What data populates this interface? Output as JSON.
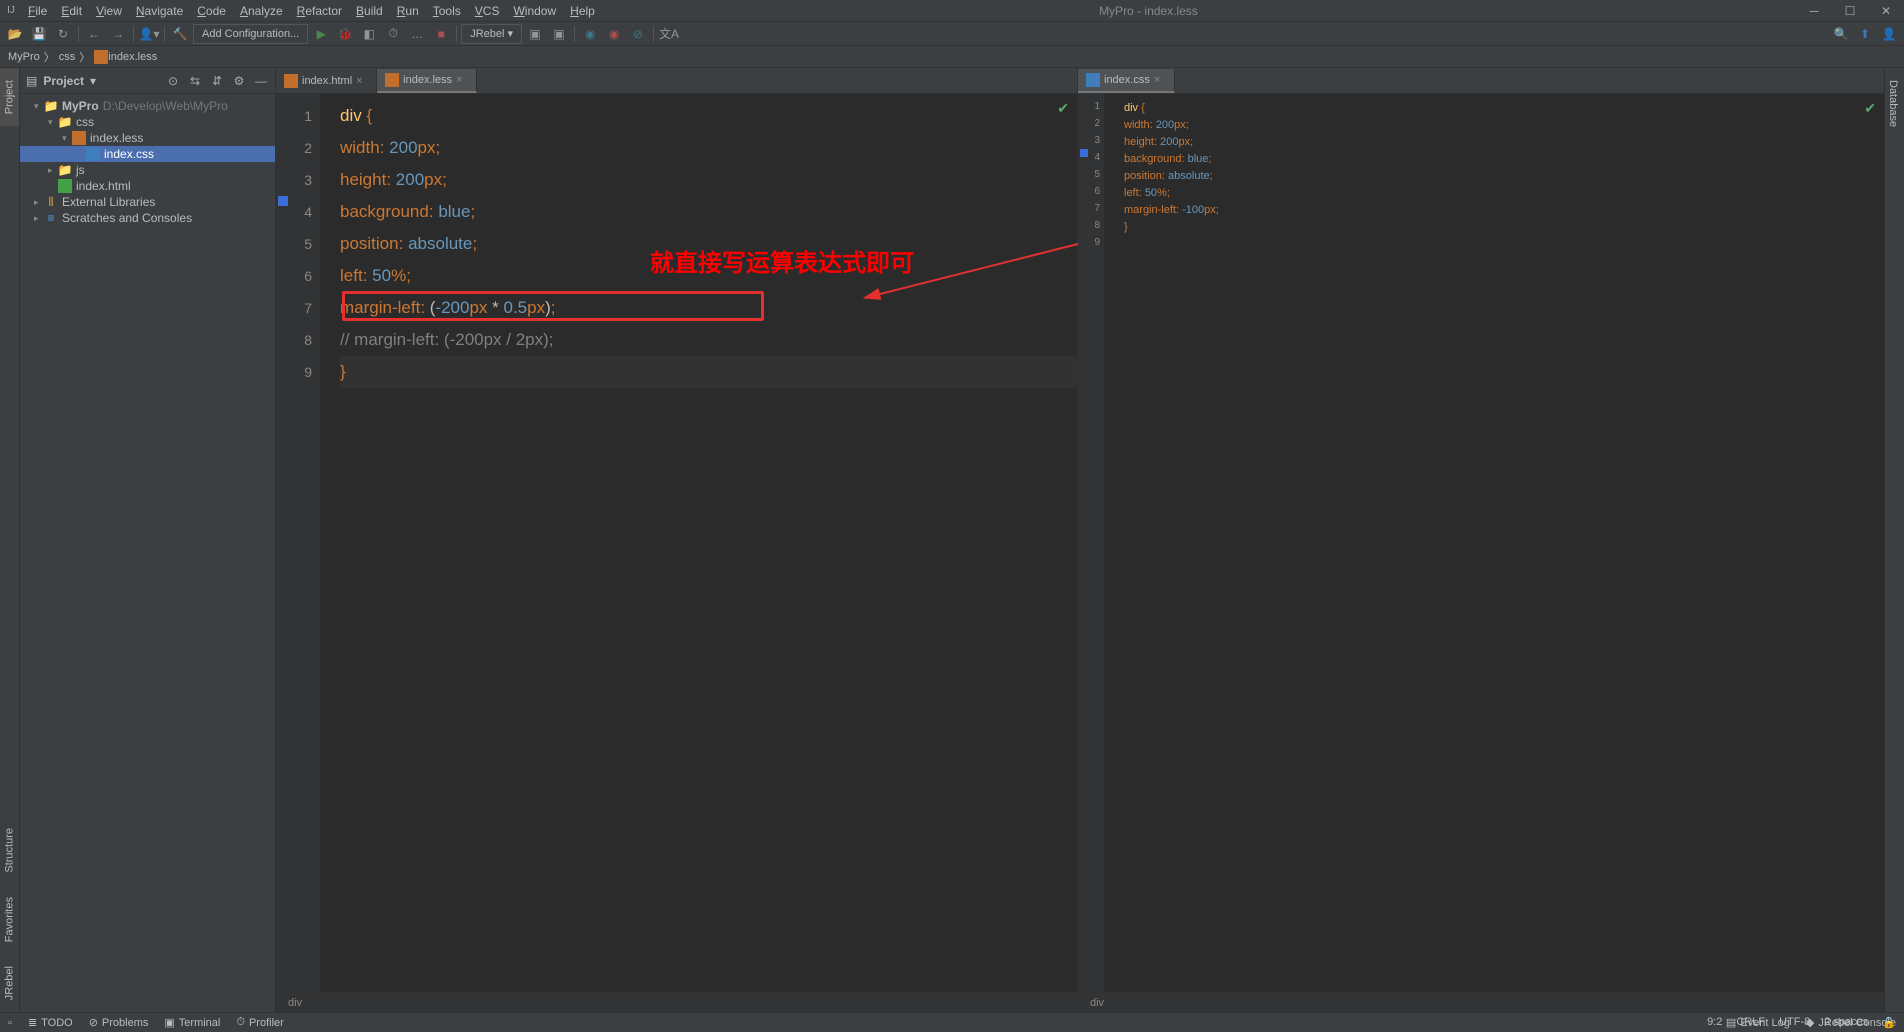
{
  "window": {
    "title": "MyPro - index.less"
  },
  "menu": [
    "File",
    "Edit",
    "View",
    "Navigate",
    "Code",
    "Analyze",
    "Refactor",
    "Build",
    "Run",
    "Tools",
    "VCS",
    "Window",
    "Help"
  ],
  "toolbar2": {
    "config": "Add Configuration...",
    "jrebel": "JRebel"
  },
  "breadcrumb": [
    "MyPro",
    "css",
    "index.less"
  ],
  "left_tabs": {
    "project": "Project",
    "structure": "Structure",
    "favorites": "Favorites",
    "jrebel": "JRebel"
  },
  "right_tabs": {
    "database": "Database"
  },
  "project_panel": {
    "title": "Project",
    "tree": {
      "root": "MyPro",
      "root_path": "D:\\Develop\\Web\\MyPro",
      "css": "css",
      "index_less": "index.less",
      "index_css": "index.css",
      "js": "js",
      "index_html": "index.html",
      "ext_lib": "External Libraries",
      "scratches": "Scratches and Consoles"
    }
  },
  "editor_tabs_left": [
    {
      "name": "index.html",
      "active": false
    },
    {
      "name": "index.less",
      "active": true
    }
  ],
  "editor_tabs_right": [
    {
      "name": "index.css",
      "active": true
    }
  ],
  "editor_left": {
    "lines": [
      "1",
      "2",
      "3",
      "4",
      "5",
      "6",
      "7",
      "8",
      "9"
    ],
    "code": [
      {
        "type": "line",
        "tokens": [
          [
            "tag",
            "div"
          ],
          [
            "txt",
            " "
          ],
          [
            "punct",
            "{"
          ]
        ]
      },
      {
        "type": "line",
        "tokens": [
          [
            "txt",
            "  "
          ],
          [
            "key",
            "width"
          ],
          [
            "punct",
            ":"
          ],
          [
            "txt",
            " "
          ],
          [
            "num",
            "200"
          ],
          [
            "key",
            "px"
          ],
          [
            "punct",
            ";"
          ]
        ]
      },
      {
        "type": "line",
        "tokens": [
          [
            "txt",
            "  "
          ],
          [
            "key",
            "height"
          ],
          [
            "punct",
            ":"
          ],
          [
            "txt",
            " "
          ],
          [
            "num",
            "200"
          ],
          [
            "key",
            "px"
          ],
          [
            "punct",
            ";"
          ]
        ]
      },
      {
        "type": "line",
        "tokens": [
          [
            "txt",
            "  "
          ],
          [
            "key",
            "background"
          ],
          [
            "punct",
            ":"
          ],
          [
            "txt",
            " "
          ],
          [
            "val",
            "blue"
          ],
          [
            "punct",
            ";"
          ]
        ]
      },
      {
        "type": "line",
        "tokens": [
          [
            "txt",
            "  "
          ],
          [
            "key",
            "position"
          ],
          [
            "punct",
            ":"
          ],
          [
            "txt",
            " "
          ],
          [
            "val",
            "absolute"
          ],
          [
            "punct",
            ";"
          ]
        ]
      },
      {
        "type": "line",
        "tokens": [
          [
            "txt",
            "  "
          ],
          [
            "key",
            "left"
          ],
          [
            "punct",
            ":"
          ],
          [
            "txt",
            " "
          ],
          [
            "num",
            "50"
          ],
          [
            "key",
            "%"
          ],
          [
            "punct",
            ";"
          ]
        ]
      },
      {
        "type": "line",
        "tokens": [
          [
            "txt",
            "  "
          ],
          [
            "key",
            "margin-left"
          ],
          [
            "punct",
            ":"
          ],
          [
            "txt",
            " ("
          ],
          [
            "num",
            "-200"
          ],
          [
            "key",
            "px"
          ],
          [
            "txt",
            " * "
          ],
          [
            "num",
            "0.5"
          ],
          [
            "key",
            "px"
          ],
          [
            "txt",
            ")"
          ],
          [
            "punct",
            ";"
          ]
        ]
      },
      {
        "type": "line",
        "tokens": [
          [
            "comment",
            "  // margin-left: (-200px / 2px);"
          ]
        ]
      },
      {
        "type": "line",
        "tokens": [
          [
            "punct",
            "}"
          ]
        ]
      }
    ],
    "crumb": "div"
  },
  "editor_right": {
    "lines": [
      "1",
      "2",
      "3",
      "4",
      "5",
      "6",
      "7",
      "8",
      "9"
    ],
    "code": [
      {
        "tokens": [
          [
            "tag",
            "div"
          ],
          [
            "txt",
            " "
          ],
          [
            "punct",
            "{"
          ]
        ]
      },
      {
        "tokens": [
          [
            "txt",
            "  "
          ],
          [
            "key",
            "width"
          ],
          [
            "punct",
            ":"
          ],
          [
            "txt",
            " "
          ],
          [
            "num",
            "200"
          ],
          [
            "key",
            "px"
          ],
          [
            "punct",
            ";"
          ]
        ]
      },
      {
        "tokens": [
          [
            "txt",
            "  "
          ],
          [
            "key",
            "height"
          ],
          [
            "punct",
            ":"
          ],
          [
            "txt",
            " "
          ],
          [
            "num",
            "200"
          ],
          [
            "key",
            "px"
          ],
          [
            "punct",
            ";"
          ]
        ]
      },
      {
        "tokens": [
          [
            "txt",
            "  "
          ],
          [
            "key",
            "background"
          ],
          [
            "punct",
            ":"
          ],
          [
            "txt",
            " "
          ],
          [
            "val",
            "blue"
          ],
          [
            "punct",
            ";"
          ]
        ]
      },
      {
        "tokens": [
          [
            "txt",
            "  "
          ],
          [
            "key",
            "position"
          ],
          [
            "punct",
            ":"
          ],
          [
            "txt",
            " "
          ],
          [
            "val",
            "absolute"
          ],
          [
            "punct",
            ";"
          ]
        ]
      },
      {
        "tokens": [
          [
            "txt",
            "  "
          ],
          [
            "key",
            "left"
          ],
          [
            "punct",
            ":"
          ],
          [
            "txt",
            " "
          ],
          [
            "num",
            "50"
          ],
          [
            "key",
            "%"
          ],
          [
            "punct",
            ";"
          ]
        ]
      },
      {
        "tokens": [
          [
            "txt",
            "  "
          ],
          [
            "key",
            "margin-left"
          ],
          [
            "punct",
            ":"
          ],
          [
            "txt",
            " "
          ],
          [
            "num",
            "-100"
          ],
          [
            "key",
            "px"
          ],
          [
            "punct",
            ";"
          ]
        ]
      },
      {
        "tokens": [
          [
            "punct",
            "}"
          ]
        ]
      },
      {
        "tokens": [
          [
            "txt",
            ""
          ]
        ]
      }
    ],
    "crumb": "div"
  },
  "annotation": "就直接写运算表达式即可",
  "statusbar": {
    "todo": "TODO",
    "problems": "Problems",
    "terminal": "Terminal",
    "profiler": "Profiler",
    "event_log": "Event Log",
    "jrebel_console": "JRebel Console",
    "caret": "9:2",
    "lineend": "CRLF",
    "encoding": "UTF-8",
    "indent": "2 spaces"
  }
}
